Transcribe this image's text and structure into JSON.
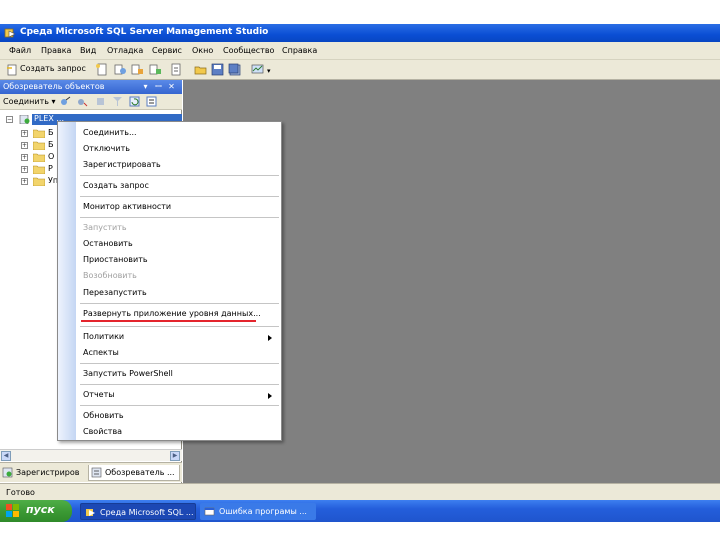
{
  "window": {
    "title": "Среда Microsoft SQL Server Management Studio"
  },
  "menubar": {
    "items": [
      "Файл",
      "Правка",
      "Вид",
      "Отладка",
      "Сервис",
      "Окно",
      "Сообщество",
      "Справка"
    ]
  },
  "toolbar": {
    "new_query_label": "Создать запрос"
  },
  "object_explorer": {
    "title": "Обозреватель объектов",
    "connect_label": "Соединить ▾",
    "server_node": "PLEX ...",
    "tree_items": [
      "Б",
      "Б",
      "О",
      "Р",
      "Уп"
    ]
  },
  "context_menu": {
    "items": [
      {
        "label": "Соединить...",
        "disabled": false
      },
      {
        "label": "Отключить",
        "disabled": false
      },
      {
        "label": "Зарегистрировать",
        "disabled": false
      },
      {
        "label": "Создать запрос",
        "disabled": false
      },
      {
        "label": "Монитор активности",
        "disabled": false
      },
      {
        "label": "Запустить",
        "disabled": true
      },
      {
        "label": "Остановить",
        "disabled": false
      },
      {
        "label": "Приостановить",
        "disabled": false
      },
      {
        "label": "Возобновить",
        "disabled": true
      },
      {
        "label": "Перезапустить",
        "disabled": false
      },
      {
        "label": "Развернуть приложение уровня данных...",
        "disabled": false
      },
      {
        "label": "Политики",
        "disabled": false,
        "submenu": true
      },
      {
        "label": "Аспекты",
        "disabled": false
      },
      {
        "label": "Запустить PowerShell",
        "disabled": false
      },
      {
        "label": "Отчеты",
        "disabled": false,
        "submenu": true
      },
      {
        "label": "Обновить",
        "disabled": false
      },
      {
        "label": "Свойства",
        "disabled": false
      }
    ]
  },
  "bottom_tabs": {
    "registered": "Зарегистриров",
    "object_explorer": "Обозреватель ..."
  },
  "statusbar": {
    "text": "Готово"
  },
  "taskbar": {
    "start_label": "пуск",
    "tasks": [
      "Среда Microsoft SQL ...",
      "Ошибка програмы ..."
    ]
  },
  "colors": {
    "titlebar": "#0a4ed4",
    "workspace": "#808080",
    "highlight_underline": "#e4252d",
    "taskbar": "#245edb",
    "start_button": "#3c9a35"
  }
}
